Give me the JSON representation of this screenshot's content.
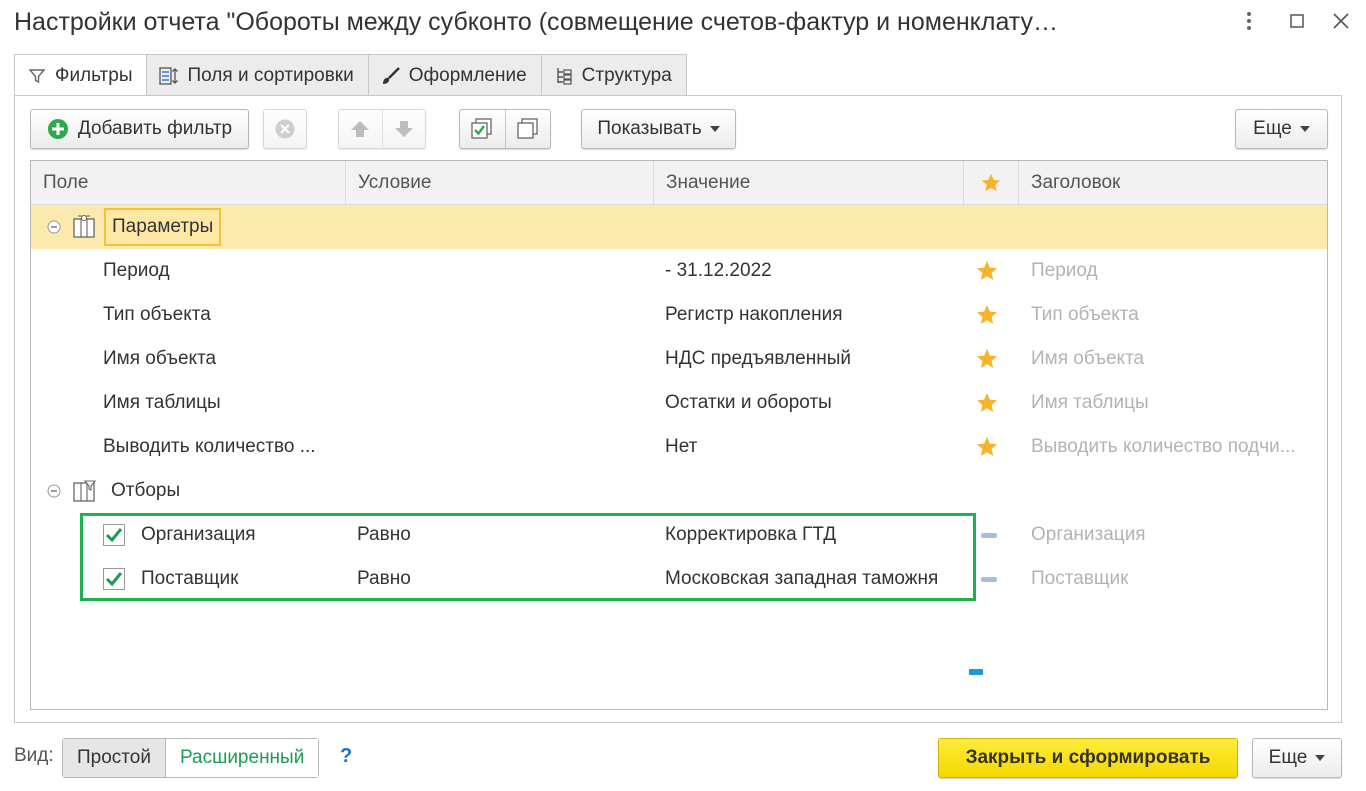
{
  "window": {
    "title": "Настройки отчета \"Обороты между субконто (совмещение счетов-фактур и номенклату…",
    "menu_icon": "vertical-dots-icon",
    "maximize_icon": "square-icon",
    "close_icon": "close-icon"
  },
  "tabs": [
    {
      "label": "Фильтры",
      "icon": "filter-icon",
      "active": true
    },
    {
      "label": "Поля и сортировки",
      "icon": "fields-sort-icon",
      "active": false
    },
    {
      "label": "Оформление",
      "icon": "brush-icon",
      "active": false
    },
    {
      "label": "Структура",
      "icon": "structure-icon",
      "active": false
    }
  ],
  "toolbar": {
    "add_filter": "Добавить фильтр",
    "show": "Показывать",
    "more": "Еще"
  },
  "grid": {
    "columns": [
      "Поле",
      "Условие",
      "Значение",
      "★",
      "Заголовок"
    ],
    "groups": [
      {
        "label": "Параметры",
        "rows": [
          {
            "field": "Период",
            "condition": "",
            "value": "- 31.12.2022",
            "title": "Период"
          },
          {
            "field": "Тип объекта",
            "condition": "",
            "value": "Регистр накопления",
            "title": "Тип объекта"
          },
          {
            "field": "Имя объекта",
            "condition": "",
            "value": "НДС предъявленный",
            "title": "Имя объекта"
          },
          {
            "field": "Имя таблицы",
            "condition": "",
            "value": "Остатки и обороты",
            "title": "Имя таблицы"
          },
          {
            "field": "Выводить количество ...",
            "condition": "",
            "value": "Нет",
            "title": "Выводить количество подчи..."
          }
        ]
      },
      {
        "label": "Отборы",
        "rows": [
          {
            "field": "Организация",
            "condition": "Равно",
            "value": "Корректировка ГТД",
            "title": "Организация",
            "checked": true
          },
          {
            "field": "Поставщик",
            "condition": "Равно",
            "value": "Московская западная таможня",
            "title": "Поставщик",
            "checked": true
          }
        ]
      }
    ]
  },
  "footer": {
    "view_label": "Вид:",
    "simple": "Простой",
    "extended": "Расширенный",
    "help": "?",
    "close_and_build": "Закрыть и сформировать",
    "more": "Еще"
  },
  "colors": {
    "accent_green": "#1eb04e",
    "star": "#f5b32e",
    "selection": "#fbe9ad",
    "primary_button": "#f5d700"
  }
}
